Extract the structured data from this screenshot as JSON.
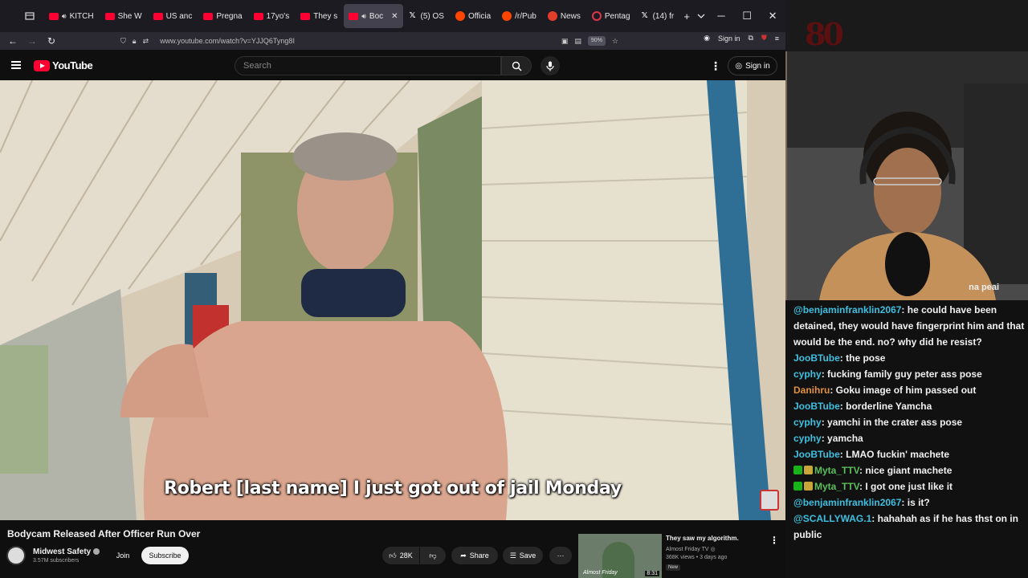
{
  "browser": {
    "tabs": [
      {
        "label": "KITCH",
        "kind": "yt",
        "speaker": true
      },
      {
        "label": "She W",
        "kind": "yt"
      },
      {
        "label": "US anc",
        "kind": "yt"
      },
      {
        "label": "Pregna",
        "kind": "yt"
      },
      {
        "label": "17yo's",
        "kind": "yt"
      },
      {
        "label": "They s",
        "kind": "yt"
      },
      {
        "label": "Boc",
        "kind": "yt",
        "active": true,
        "speaker": true
      },
      {
        "label": "(5) OS",
        "kind": "x"
      },
      {
        "label": "Officia",
        "kind": "reddit"
      },
      {
        "label": "/r/Pub",
        "kind": "reddit"
      },
      {
        "label": "News",
        "kind": "news"
      },
      {
        "label": "Pentag",
        "kind": "ring"
      },
      {
        "label": "(14) fr",
        "kind": "x"
      }
    ],
    "url": "www.youtube.com/watch?v=YJJQ6Tyng8I",
    "zoom": "90%",
    "signin_label": "Sign in"
  },
  "youtube": {
    "logo_text": "YouTube",
    "search_placeholder": "Search",
    "signin_label": "Sign in",
    "subtitle": "Robert [last name] I just got out of jail Monday",
    "video_title": "Bodycam Released After Officer Run Over",
    "channel": {
      "name": "Midwest Safety",
      "subs": "3.57M subscribers"
    },
    "join_label": "Join",
    "subscribe_label": "Subscribe",
    "likes": "28K",
    "share_label": "Share",
    "save_label": "Save",
    "recommended": {
      "title": "They saw my algorithm.",
      "channel": "Almost Friday TV",
      "meta": "368K views • 3 days ago",
      "badge": "New",
      "duration": "8:31",
      "thumb_text": "Almost Friday"
    }
  },
  "stream": {
    "logo": "80",
    "cam_tag": "na peai",
    "chat": [
      {
        "user": "@benjaminfranklin2067",
        "color": "#3ec0e0",
        "text": ": he could have been detained, they would have fingerprint him and that would be the end. no? why did he resist?"
      },
      {
        "user": "JooBTube",
        "color": "#3ec0e0",
        "text": ": the pose"
      },
      {
        "user": "cyphy",
        "color": "#3ec0e0",
        "text": ": fucking family guy peter ass pose"
      },
      {
        "user": "Danihru",
        "color": "#e0913e",
        "text": ": Goku image of him passed out"
      },
      {
        "user": "JooBTube",
        "color": "#3ec0e0",
        "text": ": borderline Yamcha"
      },
      {
        "user": "cyphy",
        "color": "#3ec0e0",
        "text": ": yamchi in the crater ass pose"
      },
      {
        "user": "cyphy",
        "color": "#3ec0e0",
        "text": ": yamcha"
      },
      {
        "user": "JooBTube",
        "color": "#3ec0e0",
        "text": ": LMAO fuckin' machete"
      },
      {
        "user": "Myta_TTV",
        "color": "#5bbf5b",
        "badges": true,
        "text": ": nice giant machete"
      },
      {
        "user": "Myta_TTV",
        "color": "#5bbf5b",
        "badges": true,
        "text": ": I got one just like it"
      },
      {
        "user": "@benjaminfranklin2067",
        "color": "#3ec0e0",
        "text": ": is it?"
      },
      {
        "user": "@SCALLYWAG.1",
        "color": "#3ec0e0",
        "text": ": hahahah as if he has thst on in public"
      }
    ]
  }
}
